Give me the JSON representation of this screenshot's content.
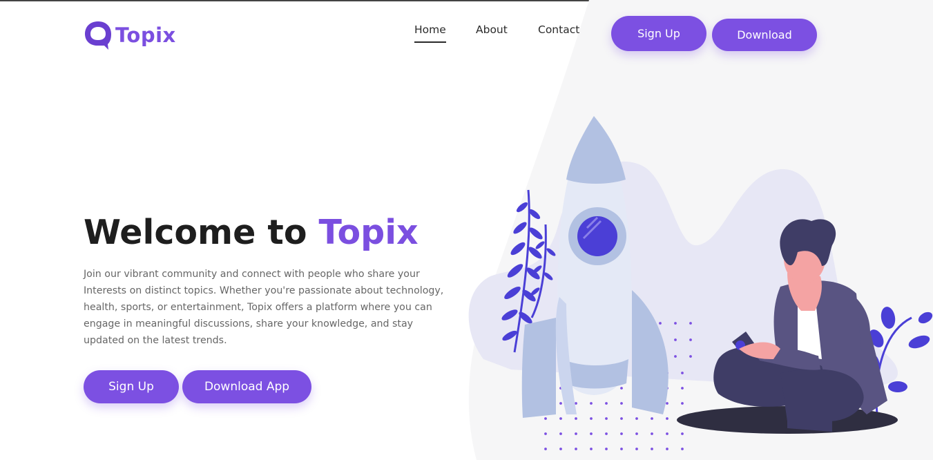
{
  "brand": {
    "name": "Topix",
    "accent_color": "#7b4fe0",
    "button_color": "#7c50e2"
  },
  "nav": {
    "items": [
      {
        "label": "Home",
        "active": true
      },
      {
        "label": "About",
        "active": false
      },
      {
        "label": "Contact",
        "active": false
      }
    ],
    "signup_label": "Sign Up",
    "download_label": "Download"
  },
  "hero": {
    "title_prefix": "Welcome to ",
    "title_accent": "Topix",
    "description": "Join our vibrant community and connect with people who share your Interests on distinct topics. Whether you're passionate about technology, health, sports, or entertainment, Topix offers a platform where you can engage in meaningful discussions, share your knowledge, and stay updated on the latest trends.",
    "signup_label": "Sign Up",
    "download_label": "Download App"
  },
  "illustration": {
    "icons": [
      "rocket-icon",
      "person-with-phone-icon",
      "leaf-icon",
      "dots-pattern"
    ]
  }
}
